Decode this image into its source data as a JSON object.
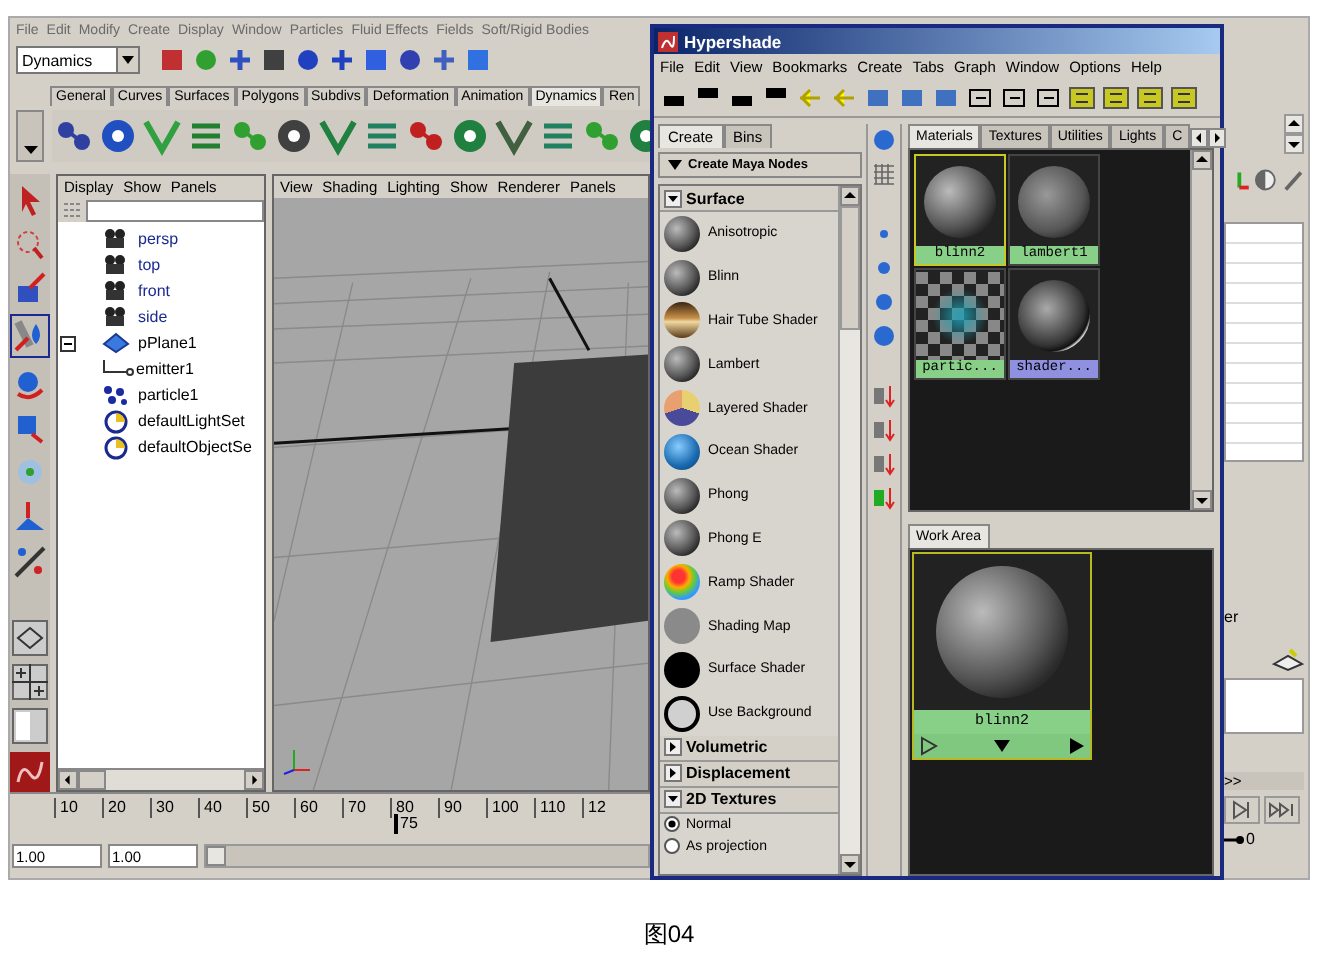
{
  "main_menu": [
    "File",
    "Edit",
    "Modify",
    "Create",
    "Display",
    "Window",
    "Particles",
    "Fluid Effects",
    "Fields",
    "Soft/Rigid Bodies"
  ],
  "menu_set": {
    "value": "Dynamics"
  },
  "shelf_tabs": [
    {
      "label": "General",
      "selected": false
    },
    {
      "label": "Curves",
      "selected": false
    },
    {
      "label": "Surfaces",
      "selected": false
    },
    {
      "label": "Polygons",
      "selected": false
    },
    {
      "label": "Subdivs",
      "selected": false
    },
    {
      "label": "Deformation",
      "selected": false
    },
    {
      "label": "Animation",
      "selected": false
    },
    {
      "label": "Dynamics",
      "selected": true
    },
    {
      "label": "Ren",
      "selected": false
    }
  ],
  "outliner": {
    "menu": [
      "Display",
      "Show",
      "Panels"
    ],
    "items": [
      {
        "label": "persp",
        "kind": "camera"
      },
      {
        "label": "top",
        "kind": "camera"
      },
      {
        "label": "front",
        "kind": "camera"
      },
      {
        "label": "side",
        "kind": "camera"
      },
      {
        "label": "pPlane1",
        "kind": "mesh",
        "expanded": true,
        "children": [
          {
            "label": "emitter1"
          }
        ]
      },
      {
        "label": "particle1",
        "kind": "particle"
      },
      {
        "label": "defaultLightSet",
        "kind": "set"
      },
      {
        "label": "defaultObjectSe",
        "kind": "set"
      }
    ]
  },
  "viewport": {
    "menu": [
      "View",
      "Shading",
      "Lighting",
      "Show",
      "Renderer",
      "Panels"
    ]
  },
  "timeline": {
    "ticks": [
      "10",
      "20",
      "30",
      "40",
      "50",
      "60",
      "70",
      "80",
      "90",
      "100",
      "110",
      "12"
    ],
    "current": "75",
    "level": 0.6
  },
  "range": {
    "start": "1.00",
    "end": "1.00",
    "level": 0
  },
  "right_panel": {
    "label": "er",
    "more": ">>",
    "key": "0"
  },
  "hypershade": {
    "title": "Hypershade",
    "menu": [
      "File",
      "Edit",
      "View",
      "Bookmarks",
      "Create",
      "Tabs",
      "Graph",
      "Window",
      "Options",
      "Help"
    ],
    "create_tabs": [
      {
        "label": "Create",
        "selected": true
      },
      {
        "label": "Bins",
        "selected": false
      }
    ],
    "create_button": "Create Maya Nodes",
    "sections": [
      {
        "label": "Surface",
        "expanded": true,
        "items": [
          {
            "label": "Anisotropic",
            "kind": "sphere"
          },
          {
            "label": "Blinn",
            "kind": "sphere"
          },
          {
            "label": "Hair Tube Shader",
            "kind": "hair"
          },
          {
            "label": "Lambert",
            "kind": "sphere"
          },
          {
            "label": "Layered Shader",
            "kind": "layered"
          },
          {
            "label": "Ocean Shader",
            "kind": "ocean"
          },
          {
            "label": "Phong",
            "kind": "sphere"
          },
          {
            "label": "Phong E",
            "kind": "sphere"
          },
          {
            "label": "Ramp Shader",
            "kind": "ramp"
          },
          {
            "label": "Shading Map",
            "kind": "flat"
          },
          {
            "label": "Surface Shader",
            "kind": "black"
          },
          {
            "label": "Use Background",
            "kind": "ring"
          }
        ]
      },
      {
        "label": "Volumetric",
        "expanded": false
      },
      {
        "label": "Displacement",
        "expanded": false
      },
      {
        "label": "2D Textures",
        "expanded": true,
        "options": [
          {
            "label": "Normal",
            "selected": true
          },
          {
            "label": "As projection",
            "selected": false
          }
        ]
      }
    ],
    "tabs": [
      {
        "label": "Materials",
        "selected": true
      },
      {
        "label": "Textures",
        "selected": false
      },
      {
        "label": "Utilities",
        "selected": false
      },
      {
        "label": "Lights",
        "selected": false
      },
      {
        "label": "C",
        "selected": false
      }
    ],
    "swatches": [
      {
        "label": "blinn2",
        "kind": "sphere",
        "selected": true,
        "color": "#88d088"
      },
      {
        "label": "lambert1",
        "kind": "matte",
        "selected": false,
        "color": "#88d088"
      },
      {
        "label": "partic...",
        "kind": "checker",
        "selected": false,
        "color": "#88d088"
      },
      {
        "label": "shader...",
        "kind": "shiny",
        "selected": false,
        "color": "#9090e0"
      }
    ],
    "work_area": {
      "tab": "Work Area",
      "label": "blinn2",
      "kind": "sphere"
    }
  },
  "caption": "图04"
}
